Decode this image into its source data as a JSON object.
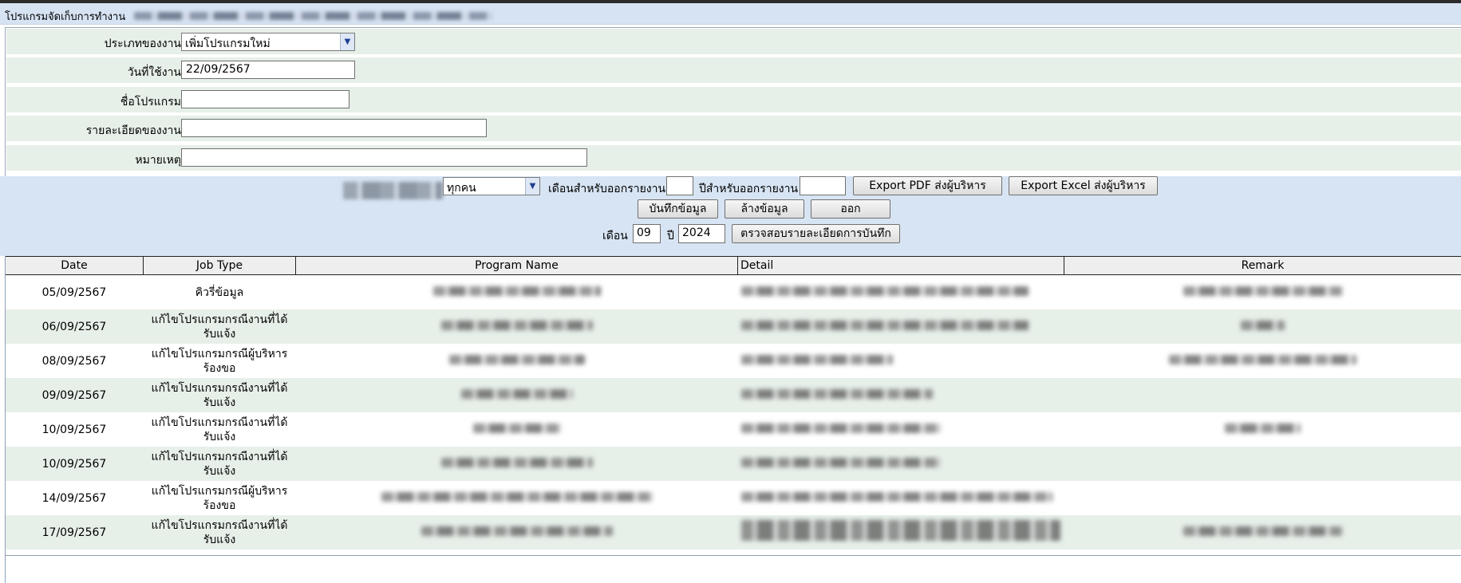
{
  "title": "โปรแกรมจัดเก็บการทำงาน",
  "form": {
    "job_type": {
      "label": "ประเภทของงาน",
      "value": "เพิ่มโปรแกรมใหม่"
    },
    "date": {
      "label": "วันที่ใช้งาน",
      "value": "22/09/2567"
    },
    "program_name": {
      "label": "ชื่อโปรแกรม",
      "value": ""
    },
    "detail": {
      "label": "รายละเอียดของงาน",
      "value": ""
    },
    "remark": {
      "label": "หมายเหตุ",
      "value": ""
    }
  },
  "report": {
    "person_select": "ทุกคน",
    "month_label": "เดือนสำหรับออกรายงาน",
    "month_value": "",
    "year_label": "ปีสำหรับออกรายงาน",
    "year_value": "",
    "export_pdf": "Export PDF ส่งผู้บริหาร",
    "export_excel": "Export Excel ส่งผู้บริหาร"
  },
  "actions": {
    "save": "บันทึกข้อมูล",
    "clear": "ล้างข้อมูล",
    "exit": "ออก"
  },
  "filter": {
    "month_label": "เดือน",
    "month_value": "09",
    "year_label": "ปี",
    "year_value": "2024",
    "check_button": "ตรวจสอบรายละเอียดการบันทึก"
  },
  "table": {
    "headers": [
      "Date",
      "Job Type",
      "Program Name",
      "Detail",
      "Remark"
    ],
    "rows": [
      {
        "date": "05/09/2567",
        "job_type": "คิวรี่ข้อมูล"
      },
      {
        "date": "06/09/2567",
        "job_type": "แก้ไขโปรแกรมกรณีงานที่ได้รับแจ้ง"
      },
      {
        "date": "08/09/2567",
        "job_type": "แก้ไขโปรแกรมกรณีผู้บริหารร้องขอ"
      },
      {
        "date": "09/09/2567",
        "job_type": "แก้ไขโปรแกรมกรณีงานที่ได้รับแจ้ง"
      },
      {
        "date": "10/09/2567",
        "job_type": "แก้ไขโปรแกรมกรณีงานที่ได้รับแจ้ง"
      },
      {
        "date": "10/09/2567",
        "job_type": "แก้ไขโปรแกรมกรณีงานที่ได้รับแจ้ง"
      },
      {
        "date": "14/09/2567",
        "job_type": "แก้ไขโปรแกรมกรณีผู้บริหารร้องขอ"
      },
      {
        "date": "17/09/2567",
        "job_type": "แก้ไขโปรแกรมกรณีงานที่ได้รับแจ้ง"
      }
    ]
  }
}
